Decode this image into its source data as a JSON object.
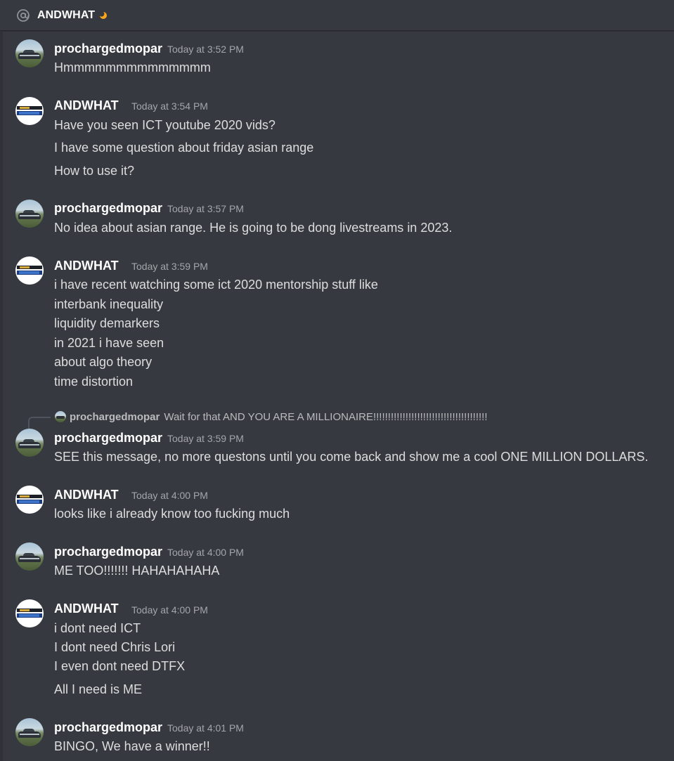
{
  "header": {
    "title": "ANDWHAT",
    "icon": "at-icon",
    "status_icon": "moon-icon"
  },
  "colors": {
    "background": "#36393f",
    "username": "#ffffff",
    "text": "#dcddde",
    "timestamp": "#a3a6aa",
    "status": "#faa61a"
  },
  "messages": [
    {
      "author": "prochargedmopar",
      "time": "Today at 3:52 PM",
      "avatar": "car-avatar",
      "lines": [
        "Hmmmmmmmmmmmmmm"
      ]
    },
    {
      "author": "ANDWHAT",
      "time": "Today at 3:54 PM",
      "avatar": "logo-avatar",
      "lines": [
        "Have you seen ICT youtube 2020 vids?",
        "I have some question about friday asian range",
        "How to use it?"
      ]
    },
    {
      "author": "prochargedmopar",
      "time": "Today at 3:57 PM",
      "avatar": "car-avatar",
      "lines": [
        "No idea about asian range.  He is going to be dong livestreams in 2023."
      ]
    },
    {
      "author": "ANDWHAT",
      "time": "Today at 3:59 PM",
      "avatar": "logo-avatar",
      "lines": [
        "i have recent watching some ict 2020 mentorship stuff like",
        "interbank inequality",
        "liquidity demarkers",
        "in 2021 i have seen",
        "about algo theory",
        "time distortion"
      ]
    },
    {
      "author": "prochargedmopar",
      "time": "Today at 3:59 PM",
      "avatar": "car-avatar",
      "reply": {
        "author": "prochargedmopar",
        "text": "Wait for that AND YOU ARE A MILLIONAIRE!!!!!!!!!!!!!!!!!!!!!!!!!!!!!!!!!!!!!!!"
      },
      "lines": [
        "SEE this message, no more questons until you come back and show me a cool ONE MILLION DOLLARS."
      ]
    },
    {
      "author": "ANDWHAT",
      "time": "Today at 4:00 PM",
      "avatar": "logo-avatar",
      "lines": [
        "looks like i already know too fucking much"
      ]
    },
    {
      "author": "prochargedmopar",
      "time": "Today at 4:00 PM",
      "avatar": "car-avatar",
      "lines": [
        "ME TOO!!!!!!! HAHAHAHAHA"
      ]
    },
    {
      "author": "ANDWHAT",
      "time": "Today at 4:00 PM",
      "avatar": "logo-avatar",
      "lines": [
        "i dont need ICT",
        "I dont need Chris Lori",
        "I even dont need DTFX",
        "All I need is ME"
      ]
    },
    {
      "author": "prochargedmopar",
      "time": "Today at 4:01 PM",
      "avatar": "car-avatar",
      "lines": [
        "BINGO, We have a winner!!"
      ]
    }
  ]
}
